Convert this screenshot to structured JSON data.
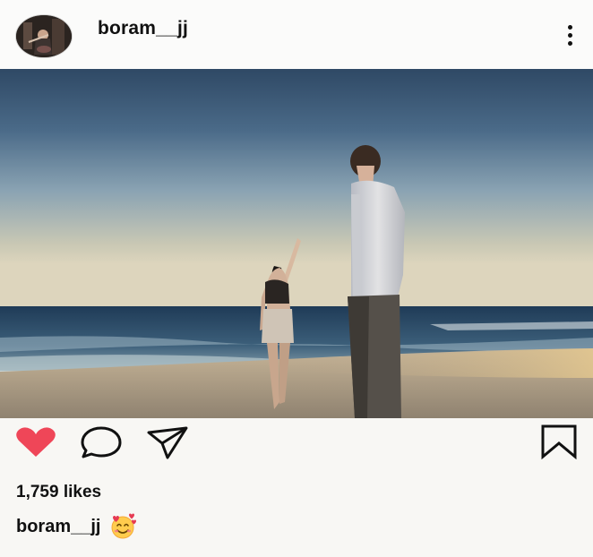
{
  "header": {
    "username": "boram__jj",
    "avatar_icon": "profile-photo-icon",
    "more_icon": "more-options-icon"
  },
  "photo": {
    "icon": "beach-couple-photo"
  },
  "actions": {
    "like_icon": "heart-filled-icon",
    "like_color": "#ef4658",
    "comment_icon": "comment-icon",
    "share_icon": "send-icon",
    "save_icon": "bookmark-icon"
  },
  "post": {
    "likes_text": "1,759 likes",
    "caption_user": "boram__jj",
    "caption_emoji": "smiling-face-with-hearts-emoji"
  }
}
